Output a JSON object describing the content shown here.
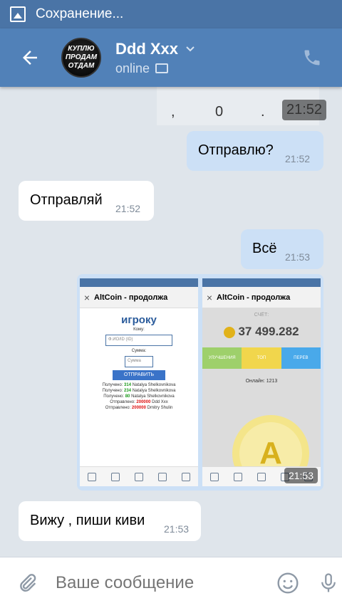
{
  "statusbar": {
    "text": "Сохранение..."
  },
  "header": {
    "name": "Ddd Xxx",
    "status": "online",
    "avatar_text": "КУПЛЮ ПРОДАМ ОТДАМ"
  },
  "top_image": {
    "chars": [
      ",",
      "0",
      "."
    ],
    "time": "21:52"
  },
  "messages": [
    {
      "text": "Отправлю?",
      "time": "21:52",
      "dir": "out"
    },
    {
      "text": "Отправляй",
      "time": "21:52",
      "dir": "in"
    },
    {
      "text": "Всё",
      "time": "21:53",
      "dir": "out"
    },
    {
      "text": "Вижу , пиши киви",
      "time": "21:53",
      "dir": "in"
    }
  ],
  "shots": {
    "time": "21:53",
    "status_time": "21:53",
    "left": {
      "tab_title": "AltCoin - продолжа",
      "heading": "игроку",
      "label_to": "Кому:",
      "placeholder_to": "Ф.ИО/ID (ID)",
      "label_sum": "Сумма:",
      "placeholder_sum": "Сумма",
      "button": "ОТПРАВИТЬ",
      "lines": [
        [
          "Получено:",
          "314",
          "Natalya Shelkovnikova"
        ],
        [
          "Получено:",
          "234",
          "Natalya Shelkovnikova"
        ],
        [
          "Получено:",
          "80",
          "Natalya Shelkovnikova"
        ],
        [
          "Отправлено:",
          "200000",
          "Ddd Xxx"
        ],
        [
          "Отправлено:",
          "200000",
          "Dmitry Shulin"
        ]
      ]
    },
    "right": {
      "tab_title": "AltCoin - продолжа",
      "score_label": "СЧЁТ:",
      "score": "37 499.282",
      "tabs": [
        "УЛУЧШЕНИЯ",
        "ТОП",
        "ПЕРЕВ"
      ],
      "online": "Онлайн: 1213",
      "big_letter": "A"
    }
  },
  "input": {
    "placeholder": "Ваше сообщение"
  },
  "colors": {
    "header": "#5181b8",
    "statusbar": "#4a74a6",
    "out_bubble": "#cce0f6",
    "in_bubble": "#ffffff",
    "chat_bg": "#dfe5eb"
  }
}
